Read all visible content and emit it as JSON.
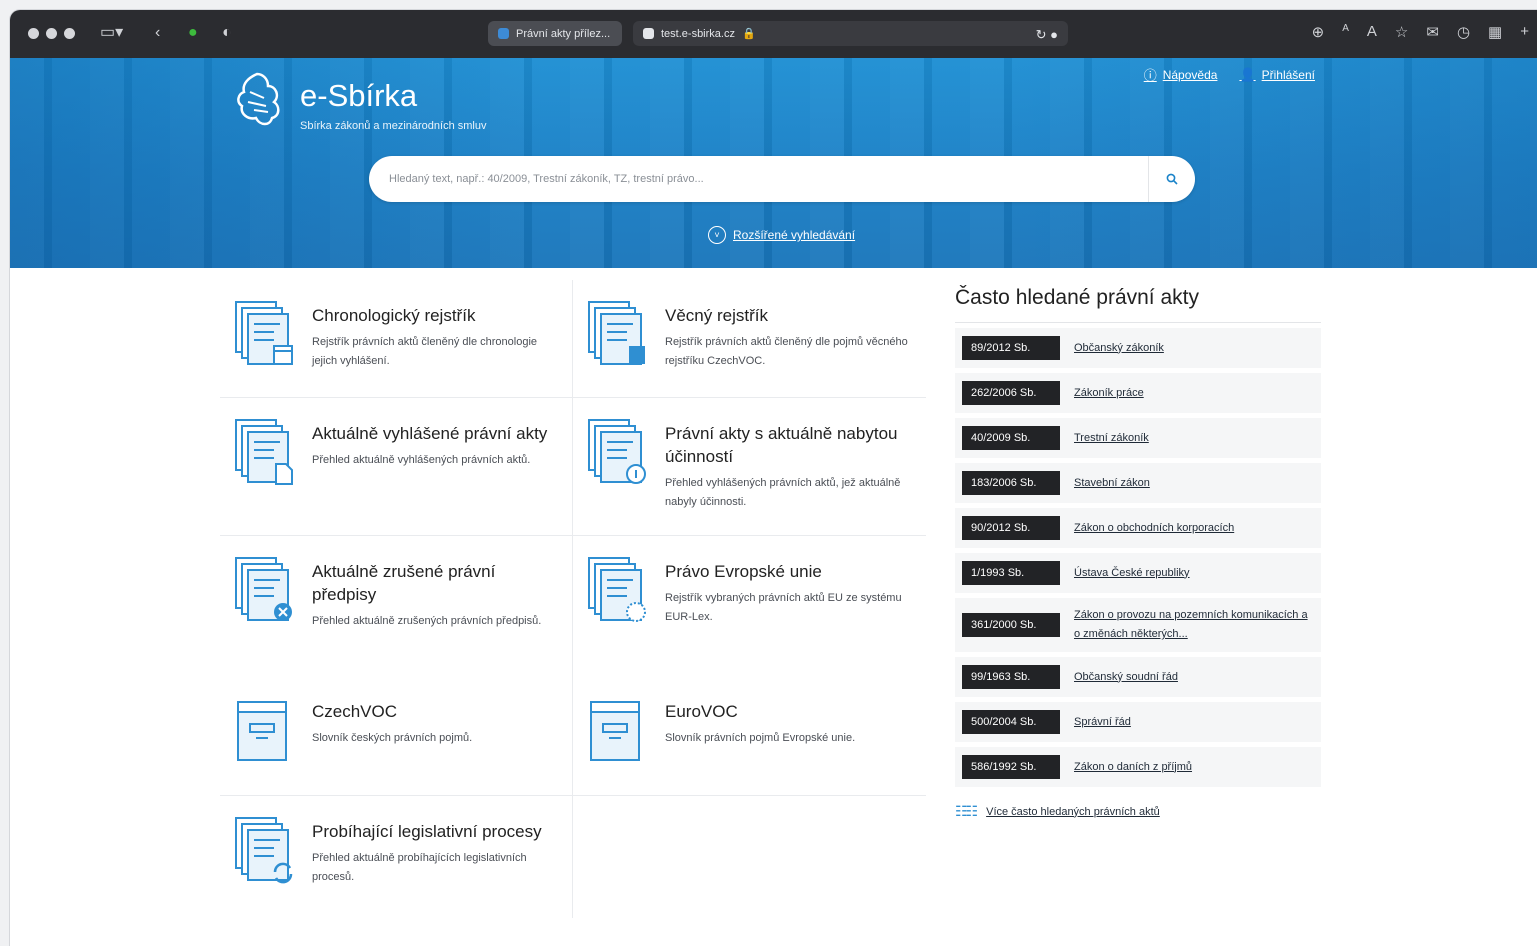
{
  "browser": {
    "active_tab_title": "Právní akty přílez...",
    "url": "test.e-sbirka.cz"
  },
  "header": {
    "logo_title": "e-Sbírka",
    "logo_subtitle": "Sbírka zákonů a mezinárodních smluv",
    "help_label": "Nápověda",
    "login_label": "Přihlášení",
    "search_placeholder": "Hledaný text, např.: 40/2009, Trestní zákoník, TZ, trestní právo...",
    "advanced_search_label": "Rozšířené vyhledávání"
  },
  "sections": [
    {
      "title": "Chronologický rejstřík",
      "desc": "Rejstřík právních aktů členěný dle chronologie jejich vyhlášení.",
      "icon": "calendar-register-icon"
    },
    {
      "title": "Věcný rejstřík",
      "desc": "Rejstřík právních aktů členěný dle pojmů věcného rejstříku CzechVOC.",
      "icon": "subject-register-icon"
    },
    {
      "title": "Aktuálně vyhlášené právní akty",
      "desc": "Přehled aktuálně vyhlášených právních aktů.",
      "icon": "new-document-icon"
    },
    {
      "title": "Právní akty s aktuálně nabytou účinností",
      "desc": "Přehled vyhlášených právních aktů, jež aktuálně nabyly účinnosti.",
      "icon": "effective-document-icon"
    },
    {
      "title": "Aktuálně zrušené právní předpisy",
      "desc": "Přehled aktuálně zrušených právních předpisů.",
      "icon": "repealed-document-icon"
    },
    {
      "title": "Právo Evropské unie",
      "desc": "Rejstřík vybraných právních aktů EU ze systému EUR-Lex.",
      "icon": "eu-document-icon"
    },
    {
      "title": "CzechVOC",
      "desc": "Slovník českých právních pojmů.",
      "icon": "dictionary-icon"
    },
    {
      "title": "EuroVOC",
      "desc": "Slovník právních pojmů Evropské unie.",
      "icon": "dictionary-icon"
    },
    {
      "title": "Probíhající legislativní procesy",
      "desc": "Přehled aktuálně probíhajících legislativních procesů.",
      "icon": "process-document-icon"
    }
  ],
  "frequent": {
    "title": "Často hledané právní akty",
    "items": [
      {
        "num": "89/2012 Sb.",
        "name": "Občanský zákoník"
      },
      {
        "num": "262/2006 Sb.",
        "name": "Zákoník práce"
      },
      {
        "num": "40/2009 Sb.",
        "name": "Trestní zákoník"
      },
      {
        "num": "183/2006 Sb.",
        "name": "Stavební zákon"
      },
      {
        "num": "90/2012 Sb.",
        "name": "Zákon o obchodních korporacích"
      },
      {
        "num": "1/1993 Sb.",
        "name": "Ústava České republiky"
      },
      {
        "num": "361/2000 Sb.",
        "name": "Zákon o provozu na pozemních komunikacích a o změnách některých..."
      },
      {
        "num": "99/1963 Sb.",
        "name": "Občanský soudní řád"
      },
      {
        "num": "500/2004 Sb.",
        "name": "Správní řád"
      },
      {
        "num": "586/1992 Sb.",
        "name": "Zákon o daních z příjmů"
      }
    ],
    "more_label": "Více často hledaných právních aktů"
  },
  "colors": {
    "hero_blue": "#1a83c9",
    "icon_blue": "#2f8fd2",
    "badge_dark": "#222326"
  }
}
